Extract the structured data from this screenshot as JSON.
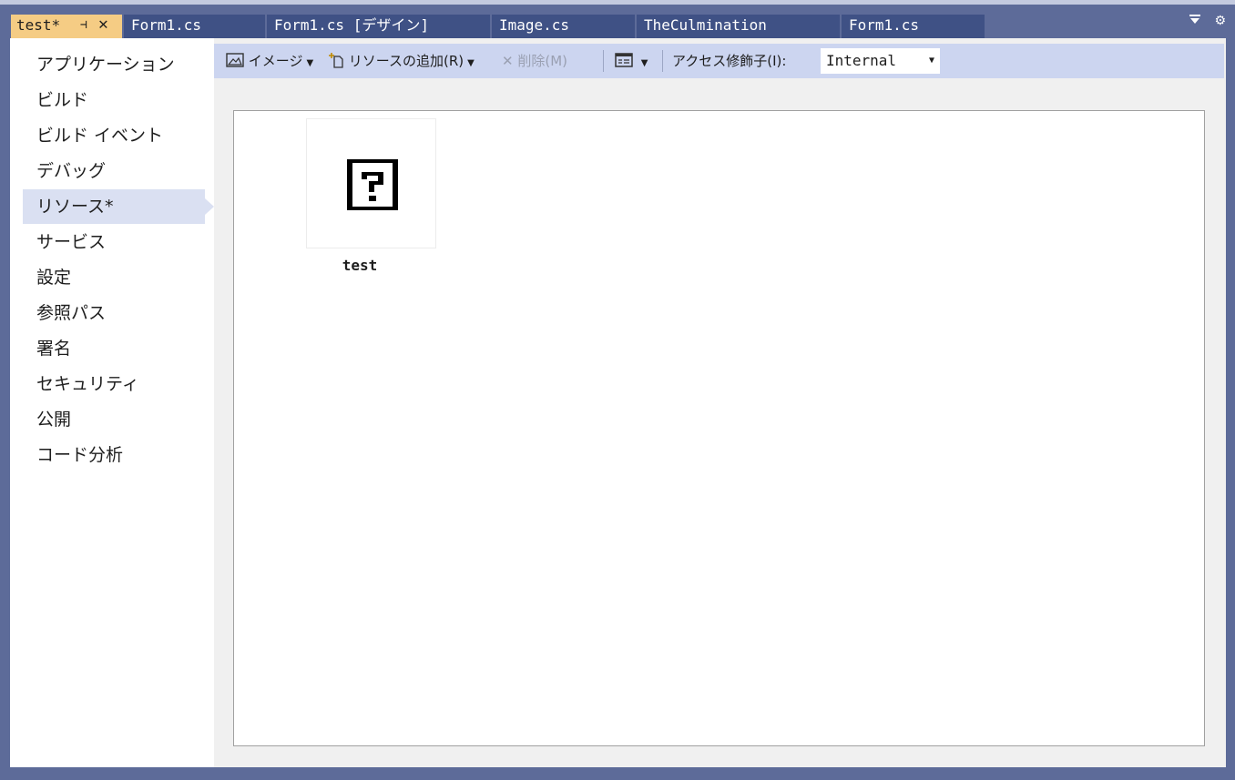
{
  "tabs": [
    {
      "label": "test*",
      "active": true
    },
    {
      "label": "Form1.cs"
    },
    {
      "label": "Form1.cs [デザイン]"
    },
    {
      "label": "Image.cs"
    },
    {
      "label": "TheCulmination"
    },
    {
      "label": "Form1.cs"
    }
  ],
  "tab_icons": {
    "pin": "pin-icon",
    "close": "close-icon",
    "overflow": "tab-list-dropdown-icon",
    "settings": "gear-icon"
  },
  "sidebar": {
    "items": [
      {
        "label": "アプリケーション"
      },
      {
        "label": "ビルド"
      },
      {
        "label": "ビルド イベント"
      },
      {
        "label": "デバッグ"
      },
      {
        "label": "リソース*",
        "selected": true
      },
      {
        "label": "サービス"
      },
      {
        "label": "設定"
      },
      {
        "label": "参照パス"
      },
      {
        "label": "署名"
      },
      {
        "label": "セキュリティ"
      },
      {
        "label": "公開"
      },
      {
        "label": "コード分析"
      }
    ]
  },
  "toolbar": {
    "image_label": "イメージ",
    "add_resource_label": "リソースの追加(R)",
    "delete_label": "削除(M)",
    "access_modifier_label": "アクセス修飾子(I):",
    "access_modifier_value": "Internal"
  },
  "resources": [
    {
      "name": "test"
    }
  ],
  "colors": {
    "chrome": "#5d6b99",
    "active_tab": "#f5cc84",
    "inactive_tab": "#3f5185",
    "toolbar": "#ccd5f0",
    "selected_nav": "#dae0f2"
  }
}
